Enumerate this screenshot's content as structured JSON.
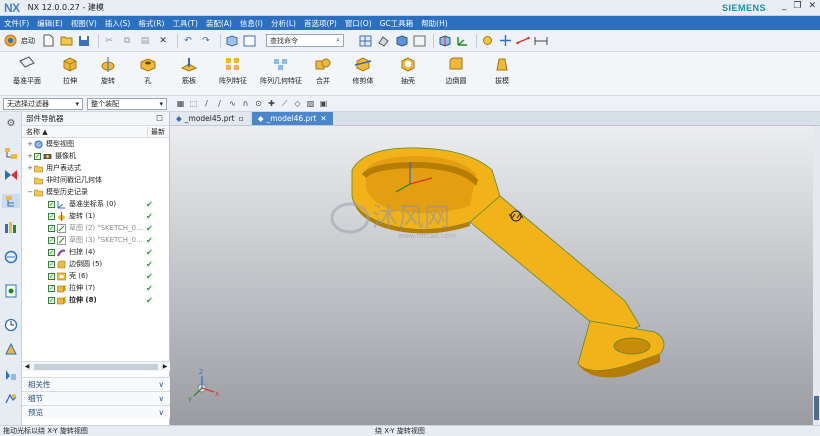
{
  "window": {
    "app_name": "NX",
    "title": "NX 12.0.0.27 - 建模",
    "brand": "SIEMENS"
  },
  "menu": [
    "文件(F)",
    "编辑(E)",
    "视图(V)",
    "插入(S)",
    "格式(R)",
    "工具(T)",
    "装配(A)",
    "信息(I)",
    "分析(L)",
    "首选项(P)",
    "窗口(O)",
    "GC工具箱",
    "帮助(H)"
  ],
  "quickbar": {
    "start_label": "启动",
    "command_finder_placeholder": "查找命令"
  },
  "ribbon": [
    {
      "label": "基准平面",
      "icon": "datum-plane-icon"
    },
    {
      "label": "拉伸",
      "icon": "extrude-icon"
    },
    {
      "label": "旋转",
      "icon": "revolve-icon"
    },
    {
      "label": "孔",
      "icon": "hole-icon"
    },
    {
      "label": "筋板",
      "icon": "rib-icon"
    },
    {
      "label": "阵列特征",
      "icon": "pattern-feature-icon"
    },
    {
      "label": "阵列几何特征",
      "icon": "pattern-geometry-icon"
    },
    {
      "label": "合并",
      "icon": "unite-icon"
    },
    {
      "label": "修剪体",
      "icon": "trim-body-icon"
    },
    {
      "label": "抽壳",
      "icon": "shell-icon"
    },
    {
      "label": "边倒圆",
      "icon": "edge-blend-icon"
    },
    {
      "label": "拔模",
      "icon": "draft-icon"
    }
  ],
  "filters": {
    "type_filter": "无选择过滤器",
    "scope": "整个装配"
  },
  "navigator": {
    "title": "部件导航器",
    "col_name": "名称",
    "col_latest": "最新",
    "tree": [
      {
        "label": "模型视图",
        "level": 0,
        "expander": "+",
        "check": false,
        "icon": "model-views-icon",
        "ok": false,
        "grey": false
      },
      {
        "label": "摄像机",
        "level": 0,
        "expander": "+",
        "check": true,
        "icon": "camera-icon",
        "ok": false,
        "grey": false
      },
      {
        "label": "用户表达式",
        "level": 0,
        "expander": "+",
        "check": false,
        "icon": "folder-icon",
        "ok": false,
        "grey": false
      },
      {
        "label": "非时间戳记几何体",
        "level": 0,
        "expander": "",
        "check": false,
        "icon": "folder-icon",
        "ok": false,
        "grey": false
      },
      {
        "label": "模型历史记录",
        "level": 0,
        "expander": "−",
        "check": false,
        "icon": "folder-icon",
        "ok": false,
        "grey": false
      },
      {
        "label": "基准坐标系 (0)",
        "level": 1,
        "expander": "",
        "check": true,
        "icon": "datum-csys-icon",
        "ok": true,
        "grey": false
      },
      {
        "label": "旋转 (1)",
        "level": 1,
        "expander": "",
        "check": true,
        "icon": "revolve-icon",
        "ok": true,
        "grey": false
      },
      {
        "label": "草图 (2) \"SKETCH_0...",
        "level": 1,
        "expander": "",
        "check": true,
        "icon": "sketch-icon",
        "ok": true,
        "grey": true
      },
      {
        "label": "草图 (3) \"SKETCH_0...",
        "level": 1,
        "expander": "",
        "check": true,
        "icon": "sketch-icon",
        "ok": true,
        "grey": true
      },
      {
        "label": "扫掠 (4)",
        "level": 1,
        "expander": "",
        "check": true,
        "icon": "sweep-icon",
        "ok": true,
        "grey": false
      },
      {
        "label": "边倒圆 (5)",
        "level": 1,
        "expander": "",
        "check": true,
        "icon": "edge-blend-icon",
        "ok": true,
        "grey": false
      },
      {
        "label": "壳 (6)",
        "level": 1,
        "expander": "",
        "check": true,
        "icon": "shell-icon",
        "ok": true,
        "grey": false
      },
      {
        "label": "拉伸 (7)",
        "level": 1,
        "expander": "",
        "check": true,
        "icon": "extrude-icon",
        "ok": true,
        "grey": false
      },
      {
        "label": "拉伸 (8)",
        "level": 1,
        "expander": "",
        "check": true,
        "icon": "extrude-icon",
        "ok": true,
        "grey": false
      }
    ],
    "sections": [
      "相关性",
      "细节",
      "预览"
    ]
  },
  "tabs": [
    {
      "label": "_model45.prt",
      "active": false
    },
    {
      "label": "_model46.prt",
      "active": true
    }
  ],
  "viewport": {
    "watermark": "沐风网",
    "watermark_sub": "www.mfcad.com",
    "csys_labels": {
      "x": "X",
      "y": "Y",
      "z": "Z"
    }
  },
  "status": {
    "left": "拖动光标以绕 X-Y 旋转视图",
    "center": "绕 X-Y 旋转视图"
  },
  "colors": {
    "menubar": "#2c6fbf",
    "part": "#f2b21a",
    "part_edge": "#5a8a2a",
    "tab_active": "#4b86c9",
    "check": "#1f9e2a"
  }
}
